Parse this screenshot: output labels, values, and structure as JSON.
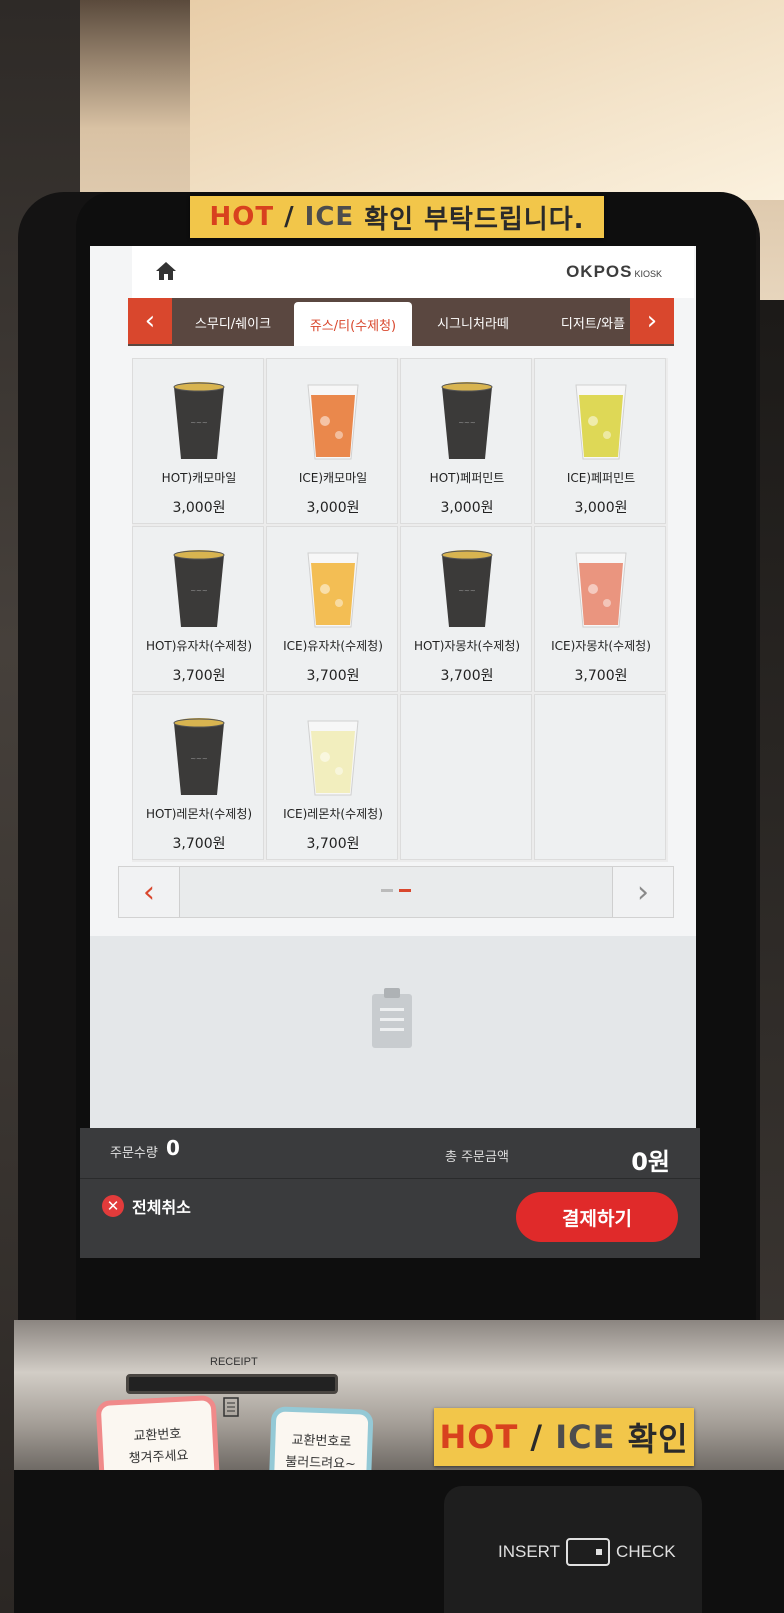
{
  "stickers": {
    "top": {
      "hot": "HOT",
      "sep": " / ",
      "ice": "ICE",
      "rest": " 확인 부탁드립니다."
    },
    "bottom": {
      "hot": "HOT",
      "sep": " / ",
      "ice": "ICE",
      "rest": " 확인"
    }
  },
  "header": {
    "brand": "OKPOS",
    "brand_sub": "KIOSK",
    "home_icon": "home-icon"
  },
  "tabs": {
    "prev_arrow": "‹",
    "next_arrow": "›",
    "items": [
      {
        "label": "스무디/쉐이크"
      },
      {
        "label": "쥬스/티(수제청)",
        "active": true
      },
      {
        "label": "시그니처라떼"
      },
      {
        "label": "디저트/와플"
      }
    ]
  },
  "menu": {
    "items": [
      {
        "name": "HOT)캐모마일",
        "price": "3,000원",
        "kind": "hot"
      },
      {
        "name": "ICE)캐모마일",
        "price": "3,000원",
        "kind": "ice-orange"
      },
      {
        "name": "HOT)페퍼민트",
        "price": "3,000원",
        "kind": "hot"
      },
      {
        "name": "ICE)페퍼민트",
        "price": "3,000원",
        "kind": "ice-yellow"
      },
      {
        "name": "HOT)유자차(수제청)",
        "price": "3,700원",
        "kind": "hot"
      },
      {
        "name": "ICE)유자차(수제청)",
        "price": "3,700원",
        "kind": "ice-yuzu"
      },
      {
        "name": "HOT)자몽차(수제청)",
        "price": "3,700원",
        "kind": "hot"
      },
      {
        "name": "ICE)자몽차(수제청)",
        "price": "3,700원",
        "kind": "ice-grapefruit"
      },
      {
        "name": "HOT)레몬차(수제청)",
        "price": "3,700원",
        "kind": "hot"
      },
      {
        "name": "ICE)레몬차(수제청)",
        "price": "3,700원",
        "kind": "ice-lemon"
      }
    ]
  },
  "pager": {
    "prev": "‹",
    "next": "›",
    "pages": 2,
    "current": 2
  },
  "order": {
    "qty_label": "주문수량",
    "qty_value": "0",
    "total_label": "총 주문금액",
    "total_value": "0원",
    "cancel_all": "전체취소",
    "pay": "결제하기"
  },
  "hardware": {
    "receipt_label": "RECEIPT",
    "note_1": "교환번호\n챙겨주세요",
    "note_2": "교환번호로\n불러드려요~",
    "insert": "INSERT",
    "check": "CHECK"
  },
  "colors": {
    "accent": "#d9472d",
    "pay": "#e02a2a",
    "tabbar": "#5a4740",
    "sticker": "#f2c64a"
  }
}
